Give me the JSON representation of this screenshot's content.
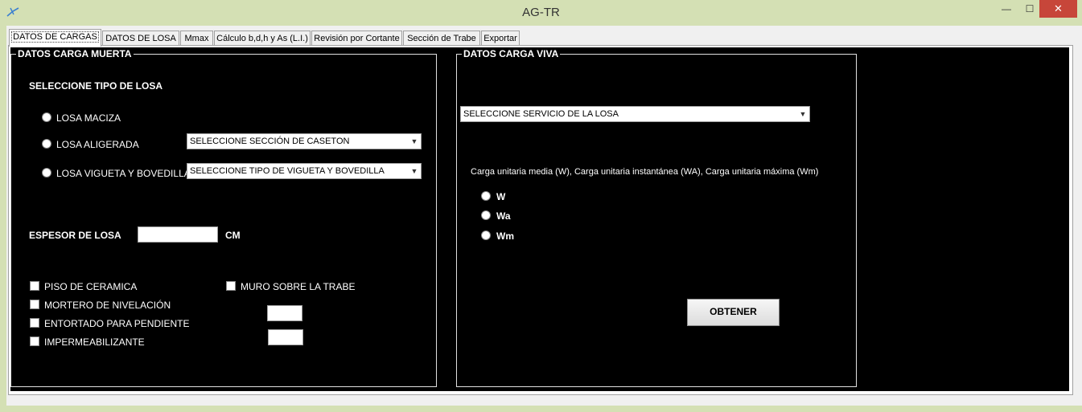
{
  "window": {
    "title": "AG-TR",
    "close_glyph": "✕",
    "min_glyph": "—",
    "max_glyph": "☐"
  },
  "tabs": [
    {
      "label": "DATOS DE CARGAS"
    },
    {
      "label": "DATOS DE LOSA"
    },
    {
      "label": "Mmax"
    },
    {
      "label": "Cálculo b,d,h y As (L.I.)"
    },
    {
      "label": "Revisión por Cortante"
    },
    {
      "label": "Sección de Trabe"
    },
    {
      "label": "Exportar"
    }
  ],
  "carga_muerta": {
    "title": "DATOS CARGA MUERTA",
    "tipo_losa_heading": "SELECCIONE TIPO DE LOSA",
    "options": [
      "LOSA MACIZA",
      "LOSA ALIGERADA",
      "LOSA VIGUETA Y BOVEDILLA"
    ],
    "caseton_combo": "SELECCIONE SECCIÓN DE CASETON",
    "vigueta_combo": "SELECCIONE TIPO DE VIGUETA Y BOVEDILLA",
    "espesor_label": "ESPESOR DE LOSA",
    "espesor_value": "",
    "espesor_unit": "CM",
    "checkboxes": [
      "PISO DE CERAMICA",
      "MORTERO DE NIVELACIÓN",
      "ENTORTADO PARA PENDIENTE",
      "IMPERMEABILIZANTE"
    ],
    "muro_checkbox": "MURO SOBRE LA TRABE",
    "muro_value_1": "",
    "muro_value_2": ""
  },
  "carga_viva": {
    "title": "DATOS CARGA VIVA",
    "servicio_combo": "SELECCIONE SERVICIO DE LA LOSA",
    "description": "Carga unitaria media (W), Carga unitaria instantánea (WA), Carga unitaria máxima (Wm)",
    "options": [
      "W",
      "Wa",
      "Wm"
    ],
    "obtener_button": "OBTENER"
  }
}
